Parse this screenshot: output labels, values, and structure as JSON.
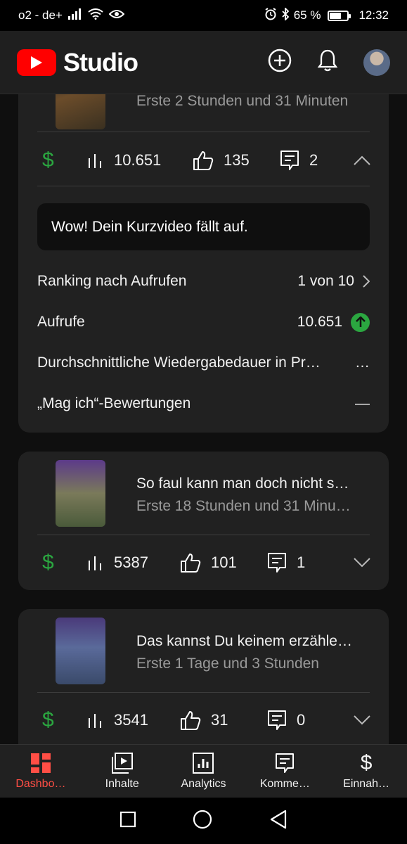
{
  "status_bar": {
    "carrier": "o2 - de+",
    "battery": "65 %",
    "battery_level": 0.65,
    "time": "12:32"
  },
  "header": {
    "app_name": "Studio",
    "icons": [
      "youtube-logo-icon",
      "create-plus-icon",
      "notifications-bell-icon",
      "account-avatar"
    ]
  },
  "videos": [
    {
      "subtitle": "Erste 2 Stunden und 31 Minuten",
      "views": "10.651",
      "likes": "135",
      "comments": "2",
      "expanded": true,
      "insight_banner": "Wow! Dein Kurzvideo fällt auf.",
      "metrics": [
        {
          "label": "Ranking nach Aufrufen",
          "value": "1 von 10"
        },
        {
          "label": "Aufrufe",
          "value": "10.651"
        },
        {
          "label": "Durchschnittliche Wiedergabedauer in Pr…",
          "value": "…"
        },
        {
          "label": "„Mag ich“-Bewertungen",
          "value": "—"
        }
      ]
    },
    {
      "title": "So faul kann man doch nicht s…",
      "subtitle": "Erste 18 Stunden und 31 Minu…",
      "views": "5387",
      "likes": "101",
      "comments": "1",
      "expanded": false
    },
    {
      "title": "Das kannst Du keinem erzähle…",
      "subtitle": "Erste 1 Tage und 3 Stunden",
      "views": "3541",
      "likes": "31",
      "comments": "0",
      "expanded": false
    }
  ],
  "bottom_nav": [
    {
      "label": "Dashbo…",
      "icon": "dashboard-icon",
      "active": true
    },
    {
      "label": "Inhalte",
      "icon": "content-icon",
      "active": false
    },
    {
      "label": "Analytics",
      "icon": "analytics-icon",
      "active": false
    },
    {
      "label": "Komme…",
      "icon": "comments-icon",
      "active": false
    },
    {
      "label": "Einnah…",
      "icon": "earn-icon",
      "active": false
    }
  ],
  "colors": {
    "accent_red": "#ff0000",
    "active_nav": "#ff4e45",
    "monetization_green": "#2ba640",
    "card_bg": "#212121",
    "page_bg": "#0f0f0f"
  }
}
